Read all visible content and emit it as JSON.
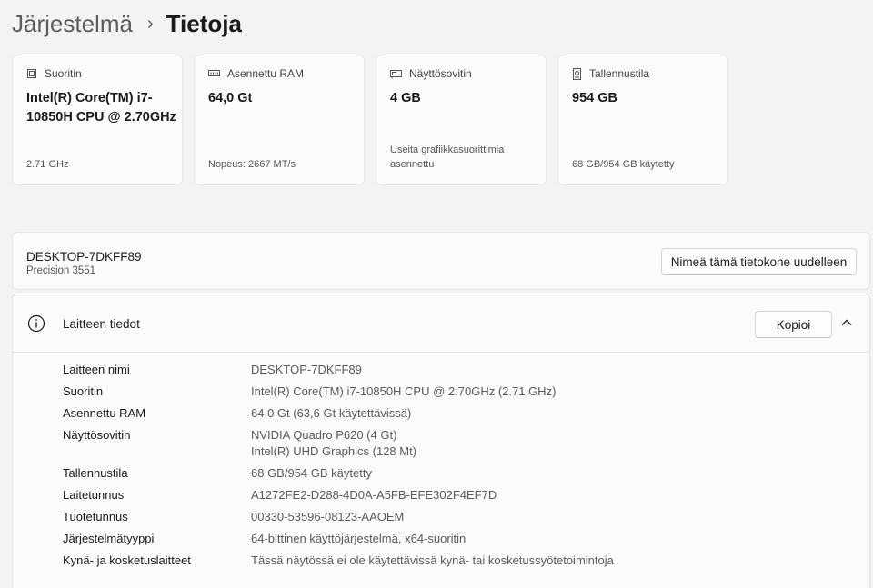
{
  "breadcrumb": {
    "parent": "Järjestelmä",
    "separator": "›",
    "current": "Tietoja"
  },
  "specs": [
    {
      "icon": "processor-icon",
      "title": "Suoritin",
      "value": "Intel(R) Core(TM) i7-10850H CPU @ 2.70GHz",
      "sub": "2.71 GHz"
    },
    {
      "icon": "ram-icon",
      "title": "Asennettu RAM",
      "value": "64,0 Gt",
      "sub": "Nopeus: 2667 MT/s"
    },
    {
      "icon": "display-adapter-icon",
      "title": "Näyttösovitin",
      "value": "4 GB",
      "sub": "Useita grafiikkasuorittimia asennettu"
    },
    {
      "icon": "storage-icon",
      "title": "Tallennustila",
      "value": "954 GB",
      "sub": "68 GB/954 GB käytetty"
    }
  ],
  "device": {
    "name": "DESKTOP-7DKFF89",
    "model": "Precision 3551",
    "rename_label": "Nimeä tämä tietokone uudelleen"
  },
  "device_info": {
    "title": "Laitteen tiedot",
    "copy_label": "Kopioi",
    "rows": [
      {
        "label": "Laitteen nimi",
        "value": "DESKTOP-7DKFF89"
      },
      {
        "label": "Suoritin",
        "value": "Intel(R) Core(TM) i7-10850H CPU @ 2.70GHz (2.71 GHz)"
      },
      {
        "label": "Asennettu RAM",
        "value": "64,0 Gt (63,6 Gt käytettävissä)"
      },
      {
        "label": "Näyttösovitin",
        "value": "NVIDIA Quadro P620 (4 Gt)",
        "value2": "Intel(R) UHD Graphics (128 Mt)"
      },
      {
        "label": "Tallennustila",
        "value": "68 GB/954 GB käytetty"
      },
      {
        "label": "Laitetunnus",
        "value": "A1272FE2-D288-4D0A-A5FB-EFE302F4EF7D"
      },
      {
        "label": "Tuotetunnus",
        "value": "00330-53596-08123-AAOEM"
      },
      {
        "label": "Järjestelmätyyppi",
        "value": "64-bittinen käyttöjärjestelmä, x64-suoritin"
      },
      {
        "label": "Kynä- ja kosketuslaitteet",
        "value": "Tässä näytössä ei ole käytettävissä kynä- tai kosketussyötetoimintoja"
      }
    ]
  }
}
